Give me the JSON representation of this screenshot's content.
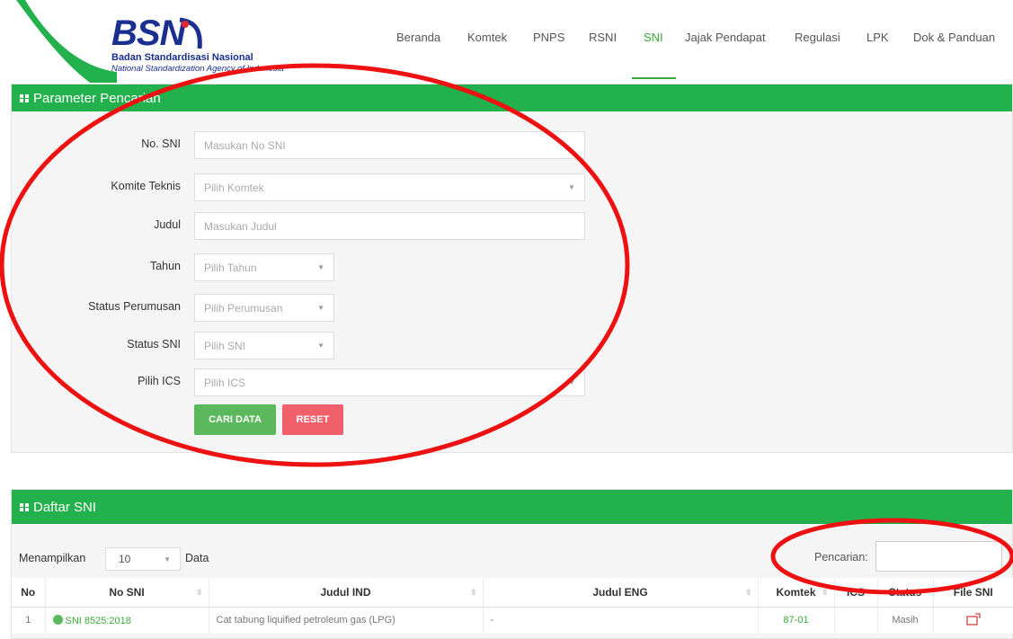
{
  "header": {
    "logo_text": "BSN",
    "org_name": "Badan Standardisasi Nasional",
    "org_name_en": "National Standardization Agency of Indonesia",
    "brand_color": "#1a2f8f",
    "accent_color": "#22b14c"
  },
  "nav": {
    "items": [
      {
        "label": "Beranda"
      },
      {
        "label": "Komtek"
      },
      {
        "label": "PNPS"
      },
      {
        "label": "RSNI"
      },
      {
        "label": "SNI",
        "active": true
      },
      {
        "label": "Jajak Pendapat"
      },
      {
        "label": "Regulasi"
      },
      {
        "label": "LPK"
      },
      {
        "label": "Dok & Panduan"
      }
    ]
  },
  "search_panel": {
    "title": "Parameter Pencarian",
    "fields": {
      "no_sni": {
        "label": "No. SNI",
        "placeholder": "Masukan No SNI"
      },
      "komtek": {
        "label": "Komite Teknis",
        "placeholder": "Pilih Komtek"
      },
      "judul": {
        "label": "Judul",
        "placeholder": "Masukan Judul"
      },
      "tahun": {
        "label": "Tahun",
        "placeholder": "Pilih Tahun"
      },
      "perumusan": {
        "label": "Status Perumusan",
        "placeholder": "Pilih Perumusan"
      },
      "status_sni": {
        "label": "Status SNI",
        "placeholder": "Pilih SNI"
      },
      "ics": {
        "label": "Pilih ICS",
        "placeholder": "Pilih ICS"
      }
    },
    "search_button": "CARI DATA",
    "reset_button": "RESET"
  },
  "list_panel": {
    "title": "Daftar SNI",
    "length_label": "Menampilkan",
    "length_value": "10",
    "length_suffix": "Data",
    "search_label": "Pencarian:",
    "columns": [
      "No",
      "No SNI",
      "Judul IND",
      "Judul ENG",
      "Komtek",
      "ICS",
      "Status",
      "File SNI"
    ],
    "rows": [
      {
        "no": "1",
        "no_sni": "SNI 8525:2018",
        "judul_ind": "Cat tabung liquified petroleum gas (LPG)",
        "judul_eng": "-",
        "komtek": "87-01",
        "ics": "",
        "status": "Masih"
      }
    ]
  }
}
